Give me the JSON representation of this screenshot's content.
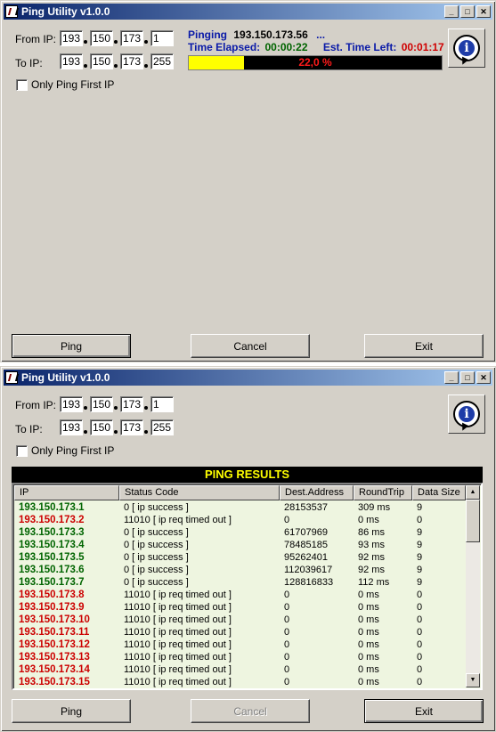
{
  "window1": {
    "title": "Ping Utility v1.0.0",
    "from_label": "From IP:",
    "to_label": "To IP:",
    "from_ip": [
      "193",
      "150",
      "173",
      "1"
    ],
    "to_ip": [
      "193",
      "150",
      "173",
      "255"
    ],
    "checkbox_label": "Only Ping First IP",
    "status": {
      "pinging_label": "Pinging",
      "pinging_ip": "193.150.173.56",
      "ellipsis": "...",
      "elapsed_label": "Time Elapsed:",
      "elapsed": "00:00:22",
      "left_label": "Est. Time Left:",
      "left": "00:01:17"
    },
    "progress": {
      "text": "22,0 %",
      "fraction": 0.22
    },
    "buttons": {
      "ping": "Ping",
      "cancel": "Cancel",
      "exit": "Exit"
    }
  },
  "window2": {
    "title": "Ping Utility v1.0.0",
    "from_label": "From IP:",
    "to_label": "To IP:",
    "from_ip": [
      "193",
      "150",
      "173",
      "1"
    ],
    "to_ip": [
      "193",
      "150",
      "173",
      "255"
    ],
    "checkbox_label": "Only Ping First IP",
    "results_title": "PING RESULTS",
    "columns": [
      "IP",
      "Status Code",
      "Dest.Address",
      "RoundTrip",
      "Data Size"
    ],
    "rows": [
      {
        "ip": "193.150.173.1",
        "status": "0 [ ip success ]",
        "dest": "28153537",
        "rtt": "309 ms",
        "size": "9",
        "ok": true
      },
      {
        "ip": "193.150.173.2",
        "status": "11010 [ ip req timed out ]",
        "dest": "0",
        "rtt": "0 ms",
        "size": "0",
        "ok": false
      },
      {
        "ip": "193.150.173.3",
        "status": "0 [ ip success ]",
        "dest": "61707969",
        "rtt": "86 ms",
        "size": "9",
        "ok": true
      },
      {
        "ip": "193.150.173.4",
        "status": "0 [ ip success ]",
        "dest": "78485185",
        "rtt": "93 ms",
        "size": "9",
        "ok": true
      },
      {
        "ip": "193.150.173.5",
        "status": "0 [ ip success ]",
        "dest": "95262401",
        "rtt": "92 ms",
        "size": "9",
        "ok": true
      },
      {
        "ip": "193.150.173.6",
        "status": "0 [ ip success ]",
        "dest": "112039617",
        "rtt": "92 ms",
        "size": "9",
        "ok": true
      },
      {
        "ip": "193.150.173.7",
        "status": "0 [ ip success ]",
        "dest": "128816833",
        "rtt": "112 ms",
        "size": "9",
        "ok": true
      },
      {
        "ip": "193.150.173.8",
        "status": "11010 [ ip req timed out ]",
        "dest": "0",
        "rtt": "0 ms",
        "size": "0",
        "ok": false
      },
      {
        "ip": "193.150.173.9",
        "status": "11010 [ ip req timed out ]",
        "dest": "0",
        "rtt": "0 ms",
        "size": "0",
        "ok": false
      },
      {
        "ip": "193.150.173.10",
        "status": "11010 [ ip req timed out ]",
        "dest": "0",
        "rtt": "0 ms",
        "size": "0",
        "ok": false
      },
      {
        "ip": "193.150.173.11",
        "status": "11010 [ ip req timed out ]",
        "dest": "0",
        "rtt": "0 ms",
        "size": "0",
        "ok": false
      },
      {
        "ip": "193.150.173.12",
        "status": "11010 [ ip req timed out ]",
        "dest": "0",
        "rtt": "0 ms",
        "size": "0",
        "ok": false
      },
      {
        "ip": "193.150.173.13",
        "status": "11010 [ ip req timed out ]",
        "dest": "0",
        "rtt": "0 ms",
        "size": "0",
        "ok": false
      },
      {
        "ip": "193.150.173.14",
        "status": "11010 [ ip req timed out ]",
        "dest": "0",
        "rtt": "0 ms",
        "size": "0",
        "ok": false
      },
      {
        "ip": "193.150.173.15",
        "status": "11010 [ ip req timed out ]",
        "dest": "0",
        "rtt": "0 ms",
        "size": "0",
        "ok": false
      }
    ],
    "buttons": {
      "ping": "Ping",
      "cancel": "Cancel",
      "exit": "Exit"
    }
  },
  "title_buttons": {
    "minimize": "_",
    "maximize": "□",
    "close": "✕"
  },
  "icons": {
    "info": "i",
    "scroll_up": "▲",
    "scroll_down": "▼"
  },
  "colors": {
    "success": "#006400",
    "failure": "#cc0000",
    "progress_fill": "#ffff00",
    "banner_text": "#ffff00"
  }
}
